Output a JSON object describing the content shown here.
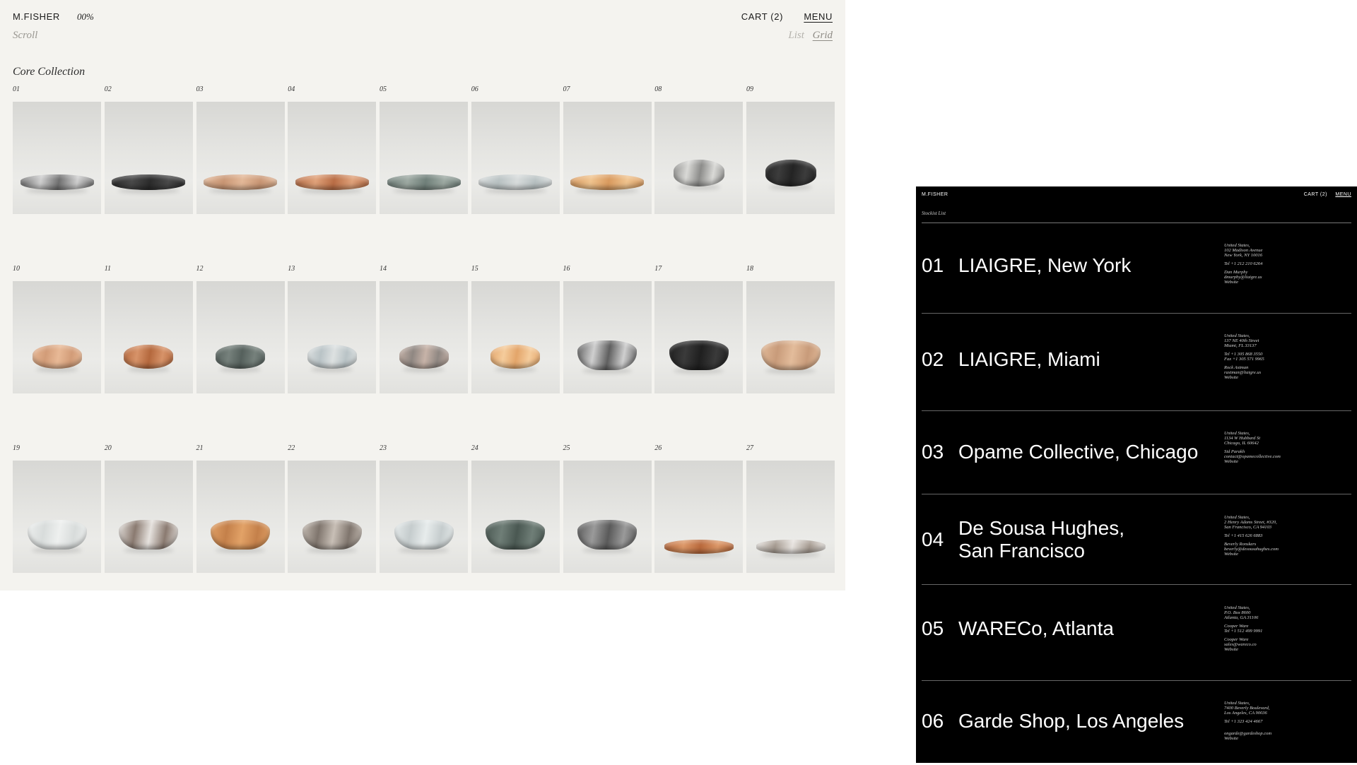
{
  "grid_page": {
    "brand": "M.FISHER",
    "progress": "00%",
    "cart": "CART (2)",
    "menu": "MENU",
    "scroll_label": "Scroll",
    "view": {
      "list": "List",
      "grid": "Grid",
      "selected": "Grid"
    },
    "collection_title": "Core Collection",
    "products": [
      {
        "num": "01",
        "stone": "#6f6f6f",
        "accent": "#cfcfcf",
        "shape": "low"
      },
      {
        "num": "02",
        "stone": "#2b2b2b",
        "accent": "#4a4a4a",
        "shape": "low"
      },
      {
        "num": "03",
        "stone": "#e3b898",
        "accent": "#c99674",
        "shape": "low"
      },
      {
        "num": "04",
        "stone": "#b96d45",
        "accent": "#e0a27a",
        "shape": "low"
      },
      {
        "num": "05",
        "stone": "#6f7f79",
        "accent": "#9eaaa3",
        "shape": "low"
      },
      {
        "num": "06",
        "stone": "#d8dcdc",
        "accent": "#b8c1c2",
        "shape": "low"
      },
      {
        "num": "07",
        "stone": "#d99a5e",
        "accent": "#f0c48f",
        "shape": "low"
      },
      {
        "num": "08",
        "stone": "#8c8c8a",
        "accent": "#d9d9d6",
        "shape": "deep"
      },
      {
        "num": "09",
        "stone": "#232323",
        "accent": "#3c3c3c",
        "shape": "deep"
      },
      {
        "num": "10",
        "stone": "#e8b996",
        "accent": "#d29c78",
        "shape": "mid"
      },
      {
        "num": "11",
        "stone": "#b4683d",
        "accent": "#d79369",
        "shape": "mid"
      },
      {
        "num": "12",
        "stone": "#55605c",
        "accent": "#76817c",
        "shape": "mid"
      },
      {
        "num": "13",
        "stone": "#dde1e1",
        "accent": "#b9c3c6",
        "shape": "mid"
      },
      {
        "num": "14",
        "stone": "#c7b3a8",
        "accent": "#8f8782",
        "shape": "mid"
      },
      {
        "num": "15",
        "stone": "#e3a56a",
        "accent": "#f5cc9c",
        "shape": "mid"
      },
      {
        "num": "16",
        "stone": "#5f5f5f",
        "accent": "#cfcfcf",
        "shape": "footed"
      },
      {
        "num": "17",
        "stone": "#1f1f1f",
        "accent": "#3a3a3a",
        "shape": "footed"
      },
      {
        "num": "18",
        "stone": "#e3bc9b",
        "accent": "#c89b7a",
        "shape": "footed"
      },
      {
        "num": "19",
        "stone": "#eef0ef",
        "accent": "#d8dcdb",
        "shape": "footed"
      },
      {
        "num": "20",
        "stone": "#e6e2de",
        "accent": "#8a7a70",
        "shape": "footed"
      },
      {
        "num": "21",
        "stone": "#e2a267",
        "accent": "#c4804a",
        "shape": "footed"
      },
      {
        "num": "22",
        "stone": "#c8bfb6",
        "accent": "#7f756d",
        "shape": "footed"
      },
      {
        "num": "23",
        "stone": "#e7ecec",
        "accent": "#c5cccd",
        "shape": "footed"
      },
      {
        "num": "24",
        "stone": "#4a5852",
        "accent": "#6f7e77",
        "shape": "footed"
      },
      {
        "num": "25",
        "stone": "#5a5a5a",
        "accent": "#9a9a9a",
        "shape": "footed"
      },
      {
        "num": "26",
        "stone": "#b9693c",
        "accent": "#dd9868",
        "shape": "plate"
      },
      {
        "num": "27",
        "stone": "#e7e3df",
        "accent": "#a59a90",
        "shape": "plate"
      }
    ]
  },
  "stockist_page": {
    "brand": "M.FISHER",
    "cart": "CART (2)",
    "menu": "MENU",
    "title": "Stockist List",
    "stockists": [
      {
        "num": "01",
        "name": "LIAIGRE, New York",
        "info": [
          "United States,",
          "102 Madison Avenue",
          "New York, NY 10016",
          "",
          "Tel +1 212 210 6264",
          "",
          "Dan Murphy",
          "dmurphy@liaigre.us",
          "Website"
        ]
      },
      {
        "num": "02",
        "name": "LIAIGRE, Miami",
        "info": [
          "United States,",
          "137 NE 40th Street",
          "Miami, FL 33137",
          "",
          "Tel +1 305 868 3550",
          "Fax +1 305 571 9965",
          "",
          "Rock Axtman",
          "raxtman@liaigre.us",
          "Website"
        ]
      },
      {
        "num": "03",
        "name": "Opame Collective, Chicago",
        "info": [
          "United States,",
          "1134 W Hubbard St",
          "Chicago, IL 60642",
          "",
          "Sid Parakh",
          "contact@opamecollective.com",
          "Website"
        ]
      },
      {
        "num": "04",
        "name": "De Sousa Hughes, San Francisco",
        "name_lines": [
          "De Sousa Hughes,",
          "San Francisco"
        ],
        "info": [
          "United States,",
          "2 Henry Adams Street, #320,",
          "San Francisco, CA 94103",
          "",
          "Tel +1 415 626 6883",
          "",
          "Beverly Ronskers",
          "beverly@desousahughes.com",
          "Website"
        ]
      },
      {
        "num": "05",
        "name": "WARECo, Atlanta",
        "info": [
          "United States,",
          "P.O. Box 8600",
          "Atlanta, GA 31106",
          "",
          "Cooper Ware",
          "Tel +1 512 499 9991",
          "",
          "Cooper Ware",
          "sales@wareco.co",
          "Website"
        ]
      },
      {
        "num": "06",
        "name": "Garde Shop, Los Angeles",
        "info": [
          "United States,",
          "7400 Beverly Boulevard,",
          "Los Angeles, CA 90036",
          "",
          "Tel +1 323 424 4667",
          "",
          "",
          "ongarde@gardeshop.com",
          "Website"
        ]
      }
    ]
  }
}
